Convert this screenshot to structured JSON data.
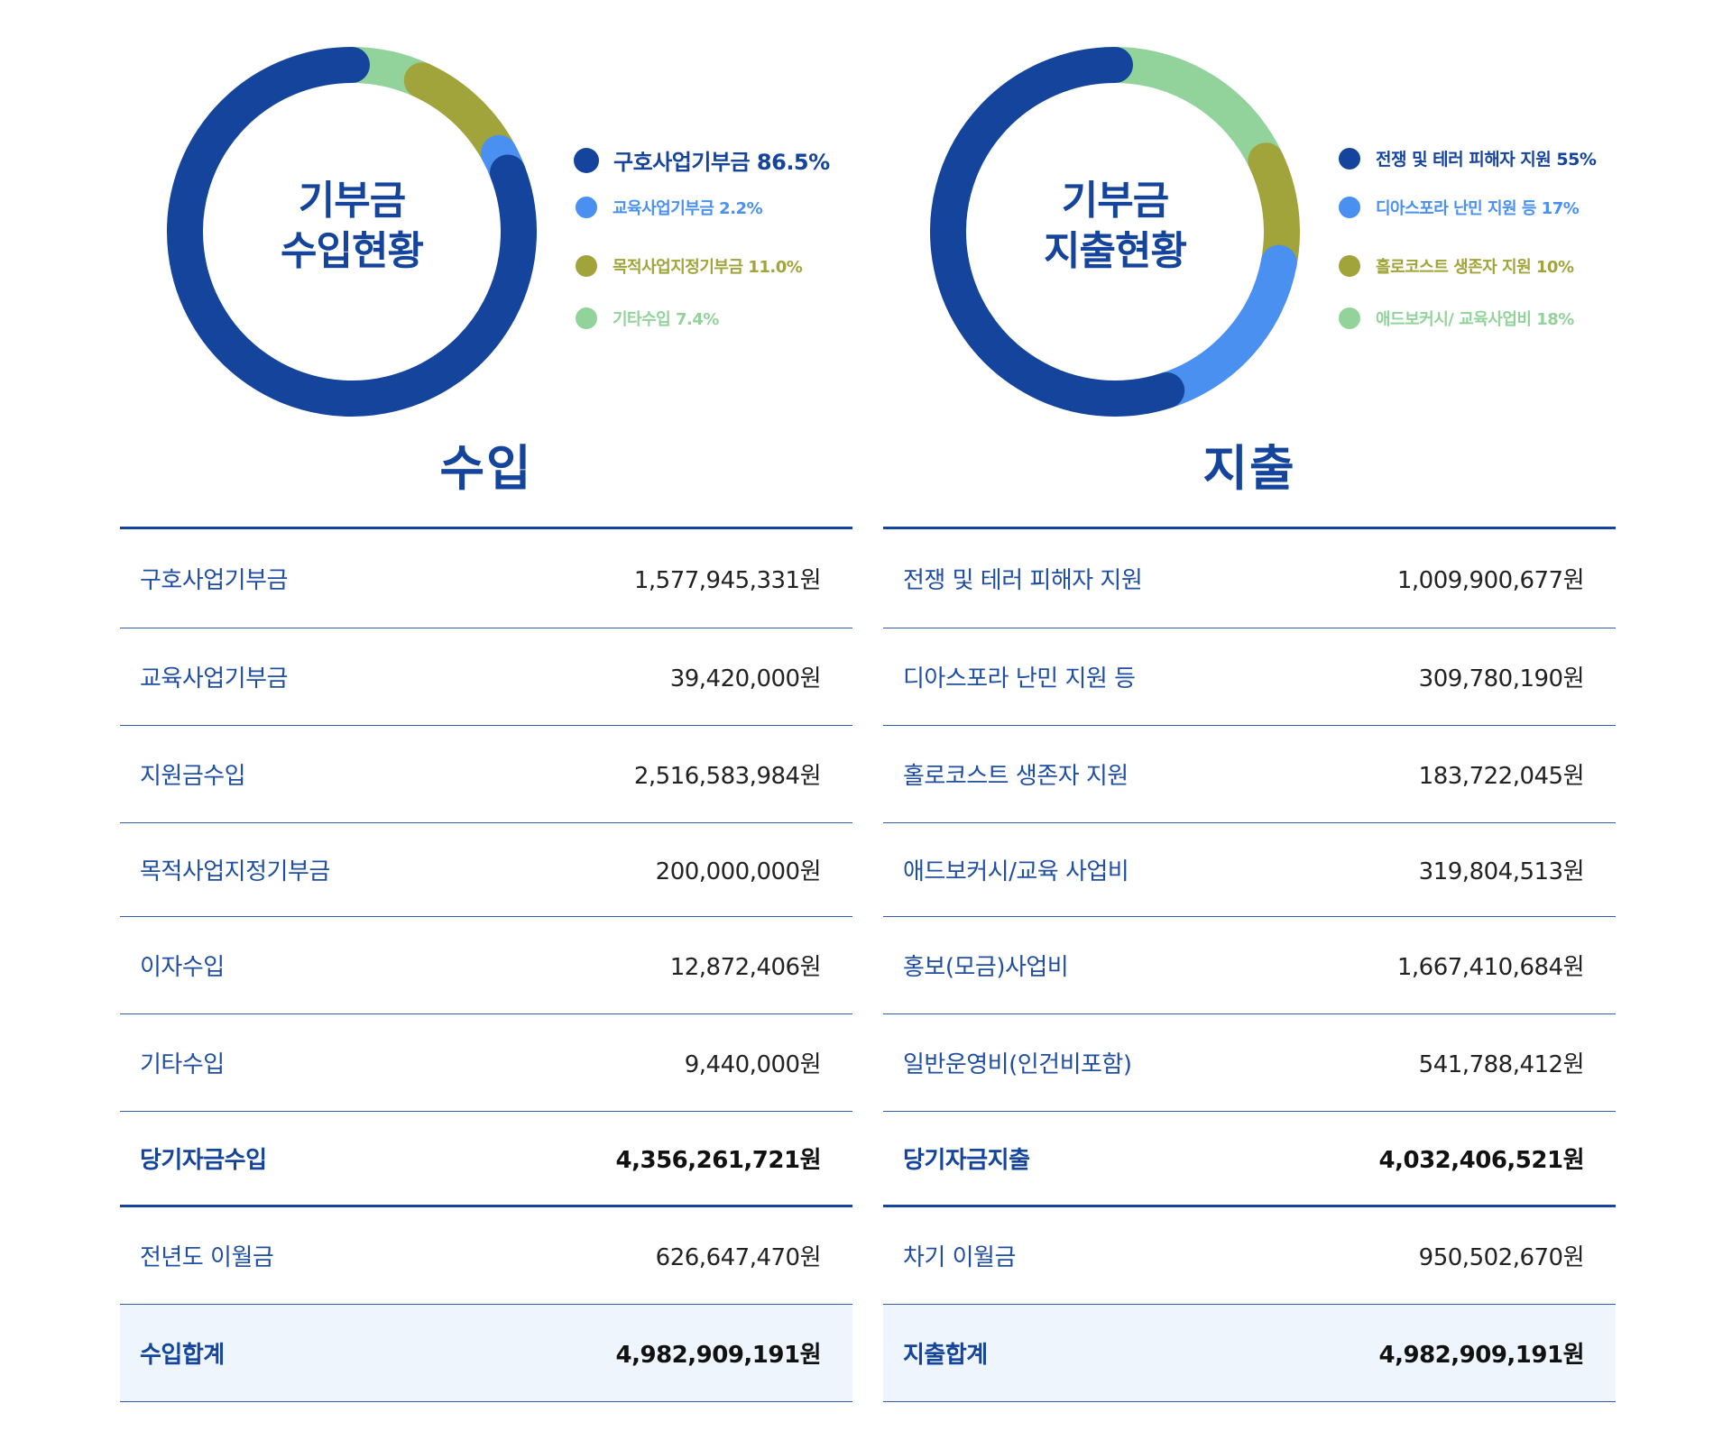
{
  "chart_data": [
    {
      "type": "pie",
      "title": "기부금 수입현황",
      "title_lines": [
        "기부금",
        "수입현황"
      ],
      "categories": [
        "구호사업기부금",
        "교육사업기부금",
        "목적사업지정기부금",
        "기타수입"
      ],
      "values": [
        86.5,
        2.2,
        11.0,
        7.4
      ],
      "legend_labels": [
        "구호사업기부금 86.5%",
        "교육사업기부금 2.2%",
        "목적사업지정기부금 11.0%",
        "기타수입 7.4%"
      ],
      "colors": [
        "#15449c",
        "#4a90f0",
        "#a0a43a",
        "#92d29b"
      ],
      "legend": "right",
      "style": "donut"
    },
    {
      "type": "pie",
      "title": "기부금 지출현황",
      "title_lines": [
        "기부금",
        "지출현황"
      ],
      "categories": [
        "전쟁 및 테러 피해자 지원",
        "디아스포라 난민 지원 등",
        "홀로코스트 생존자 지원",
        "애드보커시/ 교육사업비"
      ],
      "values": [
        55,
        17,
        10,
        18
      ],
      "legend_labels": [
        "전쟁 및 테러 피해자 지원 55%",
        "디아스포라 난민 지원 등 17%",
        "홀로코스트 생존자 지원 10%",
        "애드보커시/ 교육사업비 18%"
      ],
      "colors": [
        "#15449c",
        "#4a90f0",
        "#a0a43a",
        "#92d29b"
      ],
      "legend": "right",
      "style": "donut"
    },
    {
      "type": "table",
      "title": "수입",
      "rows": [
        {
          "category": "구호사업기부금",
          "value": "1,577,945,331원"
        },
        {
          "category": "교육사업기부금",
          "value": "39,420,000원"
        },
        {
          "category": "지원금수입",
          "value": "2,516,583,984원"
        },
        {
          "category": "목적사업지정기부금",
          "value": "200,000,000원"
        },
        {
          "category": "이자수입",
          "value": "12,872,406원"
        },
        {
          "category": "기타수입",
          "value": "9,440,000원"
        },
        {
          "category": "당기자금수입",
          "value": "4,356,261,721원",
          "bold": true
        },
        {
          "category": "전년도 이월금",
          "value": "626,647,470원"
        },
        {
          "category": "수입합계",
          "value": "4,982,909,191원",
          "bold": true,
          "shaded": true
        }
      ]
    },
    {
      "type": "table",
      "title": "지출",
      "rows": [
        {
          "category": "전쟁 및 테러 피해자 지원",
          "value": "1,009,900,677원"
        },
        {
          "category": "디아스포라 난민 지원 등",
          "value": "309,780,190원"
        },
        {
          "category": "홀로코스트 생존자 지원",
          "value": "183,722,045원"
        },
        {
          "category": "애드보커시/교육 사업비",
          "value": "319,804,513원"
        },
        {
          "category": "홍보(모금)사업비",
          "value": "1,667,410,684원"
        },
        {
          "category": "일반운영비(인건비포함)",
          "value": "541,788,412원"
        },
        {
          "category": "당기자금지출",
          "value": "4,032,406,521원",
          "bold": true
        },
        {
          "category": "차기 이월금",
          "value": "950,502,670원"
        },
        {
          "category": "지출합계",
          "value": "4,982,909,191원",
          "bold": true,
          "shaded": true
        }
      ]
    }
  ]
}
